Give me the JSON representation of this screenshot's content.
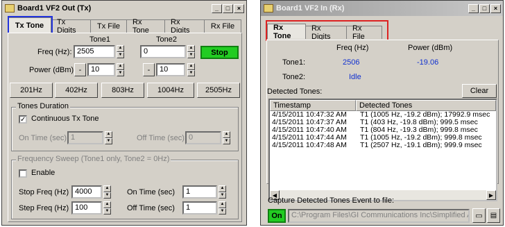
{
  "left": {
    "title": "Board1 VF2 Out (Tx)",
    "tabs": [
      "Tx Tone",
      "Tx Digits",
      "Tx File",
      "Rx Tone",
      "Rx Digits",
      "Rx File"
    ],
    "tone1_label": "Tone1",
    "tone2_label": "Tone2",
    "freq_label": "Freq (Hz):",
    "power_label": "Power (dBm):",
    "tone1_freq": "2505",
    "tone2_freq": "0",
    "tone1_power": "10",
    "tone2_power": "10",
    "minus": "-",
    "stop_label": "Stop",
    "presets": [
      "201Hz",
      "402Hz",
      "803Hz",
      "1004Hz",
      "2505Hz"
    ],
    "duration_title": "Tones Duration",
    "continuous_label": "Continuous Tx Tone",
    "continuous_checked": "✓",
    "on_time_label": "On Time (sec):",
    "on_time_value": "1",
    "off_time_label": "Off Time (sec):",
    "off_time_value": "0",
    "sweep_title": "Frequency Sweep (Tone1 only, Tone2 = 0Hz)",
    "enable_label": "Enable",
    "stop_freq_label": "Stop Freq (Hz)",
    "stop_freq_value": "4000",
    "step_freq_label": "Step Freq (Hz)",
    "step_freq_value": "100",
    "sweep_on_label": "On Time (sec)",
    "sweep_on_value": "1",
    "sweep_off_label": "Off Time (sec)",
    "sweep_off_value": "1"
  },
  "right": {
    "title": "Board1 VF2 In (Rx)",
    "tabs": [
      "Rx Tone",
      "Rx Digits",
      "Rx File"
    ],
    "freq_header": "Freq (Hz)",
    "power_header": "Power (dBm)",
    "tone1_label": "Tone1:",
    "tone1_freq": "2506",
    "tone1_power": "-19.06",
    "tone2_label": "Tone2:",
    "tone2_status": "Idle",
    "detected_label": "Detected Tones:",
    "clear_label": "Clear",
    "columns": [
      "Timestamp",
      "Detected Tones"
    ],
    "rows": [
      [
        "4/15/2011 10:47:32 AM",
        "T1 (1005 Hz, -19.2 dBm); 17992.9 msec"
      ],
      [
        "4/15/2011 10:47:37 AM",
        "T1 (403 Hz, -19.8 dBm); 999.5 msec"
      ],
      [
        "4/15/2011 10:47:40 AM",
        "T1 (804 Hz, -19.3 dBm); 999.8 msec"
      ],
      [
        "4/15/2011 10:47:44 AM",
        "T1 (1005 Hz, -19.2 dBm); 999.8 msec"
      ],
      [
        "4/15/2011 10:47:48 AM",
        "T1 (2507 Hz, -19.1 dBm); 999.9 msec"
      ]
    ],
    "capture_label": "Capture Detected Tones Event to file:",
    "on_label": "On",
    "file_path": "C:\\Program Files\\GI Communications Inc\\Simplified Audi"
  },
  "colors": {
    "stop_green": "#22cc22",
    "value_blue": "#1030d0",
    "tab_highlight_blue": "#2233dd",
    "tab_highlight_red": "#dd2222"
  }
}
